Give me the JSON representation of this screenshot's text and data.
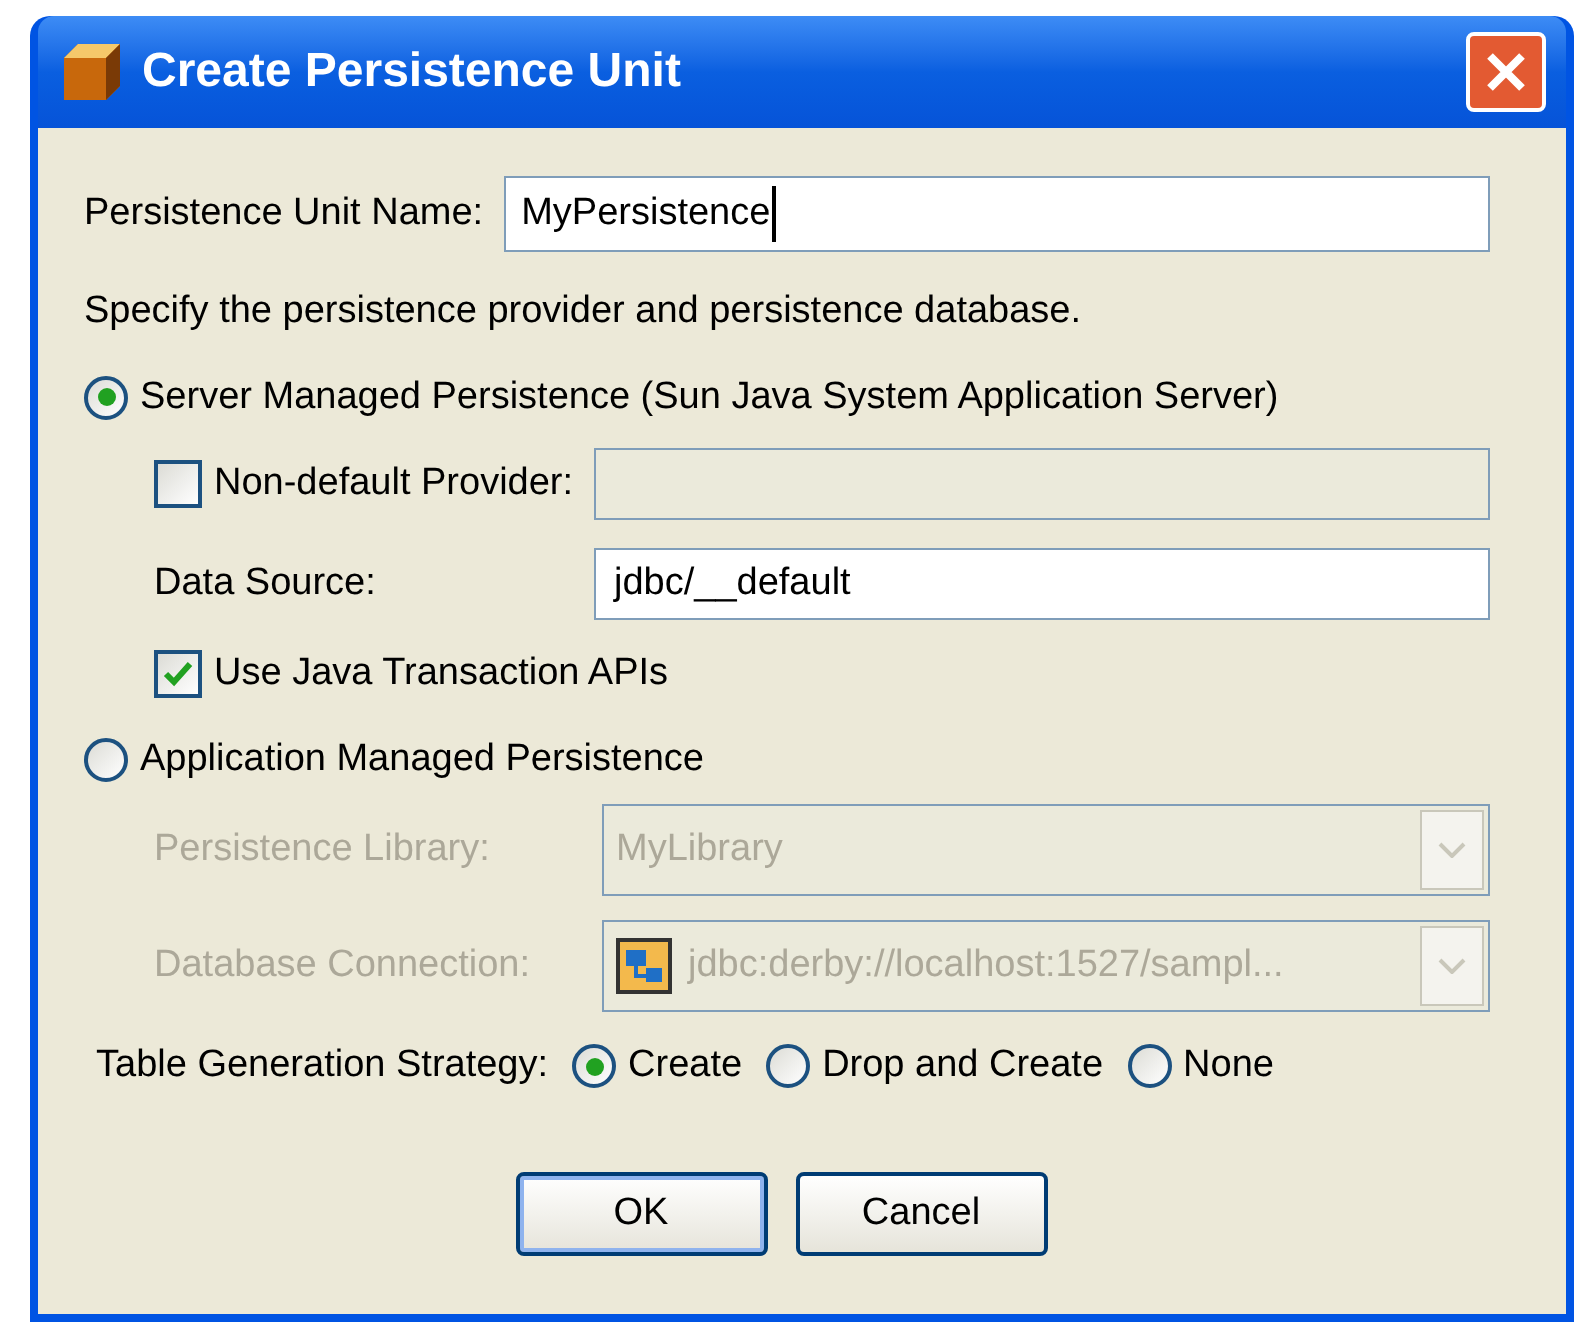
{
  "window": {
    "title": "Create Persistence Unit"
  },
  "unit_name": {
    "label": "Persistence Unit Name:",
    "value": "MyPersistence"
  },
  "instruction": "Specify the persistence provider and persistence database.",
  "server_managed": {
    "label": "Server Managed Persistence (Sun Java System Application Server)",
    "selected": true,
    "non_default_provider": {
      "label": "Non-default Provider:",
      "checked": false,
      "disabled": true
    },
    "data_source": {
      "label": "Data Source:",
      "value": "jdbc/__default"
    },
    "use_jta": {
      "label": "Use Java Transaction APIs",
      "checked": true
    }
  },
  "application_managed": {
    "label": "Application Managed Persistence",
    "selected": false,
    "persistence_library": {
      "label": "Persistence Library:",
      "value": "MyLibrary",
      "disabled": true
    },
    "database_connection": {
      "label": "Database Connection:",
      "value": "jdbc:derby://localhost:1527/sampl...",
      "disabled": true
    }
  },
  "table_generation": {
    "label": "Table Generation Strategy:",
    "options": [
      {
        "label": "Create",
        "selected": true
      },
      {
        "label": "Drop and Create",
        "selected": false
      },
      {
        "label": "None",
        "selected": false
      }
    ]
  },
  "buttons": [
    {
      "label": "OK",
      "default": true
    },
    {
      "label": "Cancel",
      "default": false
    }
  ]
}
